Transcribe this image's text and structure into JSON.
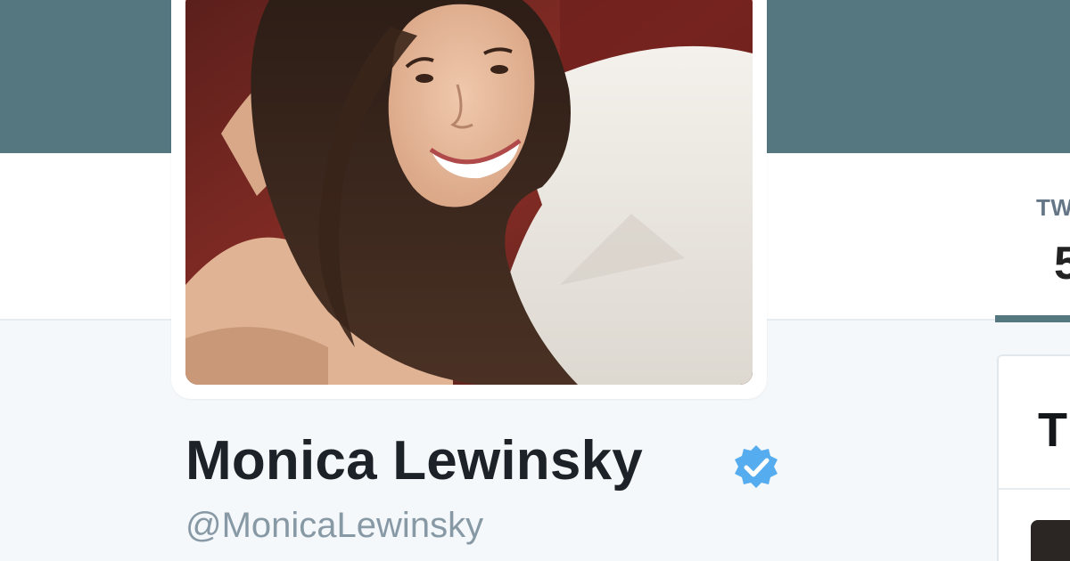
{
  "header": {
    "banner_color": "#547780"
  },
  "avatar": {
    "icon": "profile-photo"
  },
  "profile": {
    "name": "Monica Lewinsky",
    "screen_name": "@MonicaLewinsky",
    "verified": true,
    "verified_icon": "verified-check-icon",
    "verified_color": "#55acee"
  },
  "stats": {
    "tweets_label": "TW",
    "tweets_count": "5"
  },
  "side_card": {
    "title": "T"
  }
}
